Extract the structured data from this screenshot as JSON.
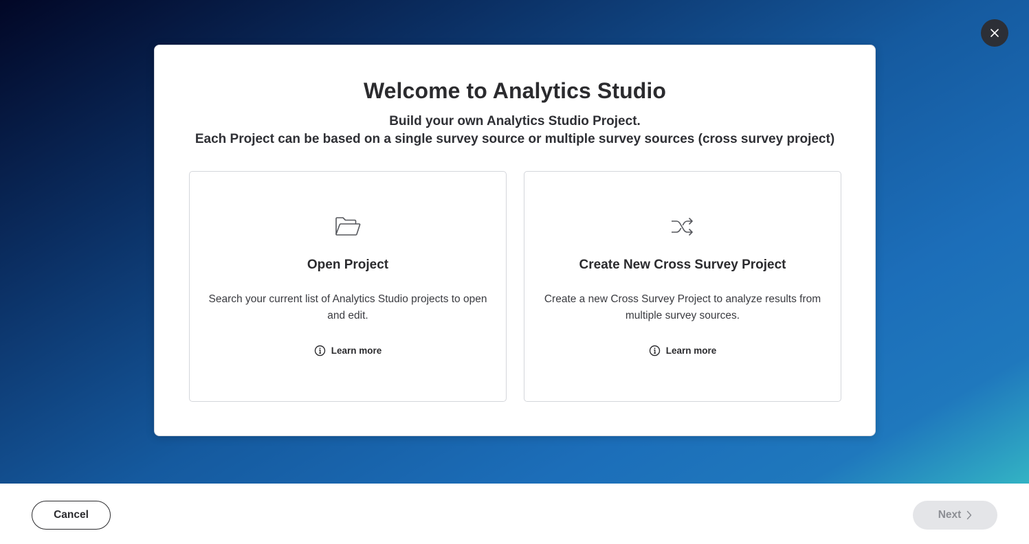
{
  "modal": {
    "title": "Welcome to Analytics Studio",
    "subtitle_line1": "Build your own Analytics Studio Project.",
    "subtitle_line2": "Each Project can be based on a single survey source or multiple survey sources (cross survey project)",
    "cards": [
      {
        "icon": "folder-open-icon",
        "title": "Open Project",
        "description": "Search your current list of Analytics Studio projects to open and edit.",
        "learn_more_label": "Learn more"
      },
      {
        "icon": "shuffle-icon",
        "title": "Create New Cross Survey Project",
        "description": "Create a new Cross Survey Project to analyze results from multiple survey sources.",
        "learn_more_label": "Learn more"
      }
    ]
  },
  "footer": {
    "cancel_label": "Cancel",
    "next_label": "Next",
    "next_disabled": true
  },
  "colors": {
    "backdrop_dark": "#020726",
    "backdrop_mid": "#1c6eb9",
    "backdrop_accent": "#33b3c4",
    "close_button_bg": "#2c2f36",
    "text_primary": "#2b2b2e",
    "next_disabled_bg": "#e4e5e8"
  }
}
